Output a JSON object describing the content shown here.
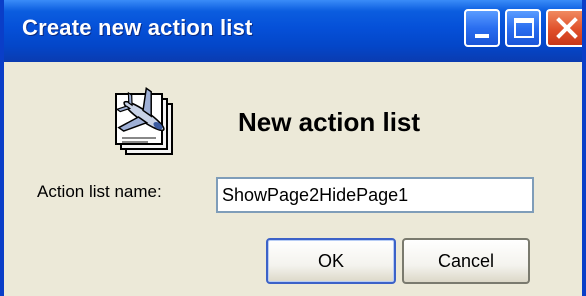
{
  "window": {
    "title": "Create new action list"
  },
  "titlebar_buttons": {
    "minimize_icon": "minimize-icon",
    "maximize_icon": "maximize-icon",
    "close_icon": "close-icon"
  },
  "dialog": {
    "icon": "airplane-pages-icon",
    "heading": "New action list",
    "field_label": "Action list name:",
    "field_value": "ShowPage2HidePage1",
    "ok_label": "OK",
    "cancel_label": "Cancel"
  },
  "colors": {
    "titlebar": "#0550d8",
    "window_face": "#ece9d8",
    "close_button": "#e0502a"
  }
}
